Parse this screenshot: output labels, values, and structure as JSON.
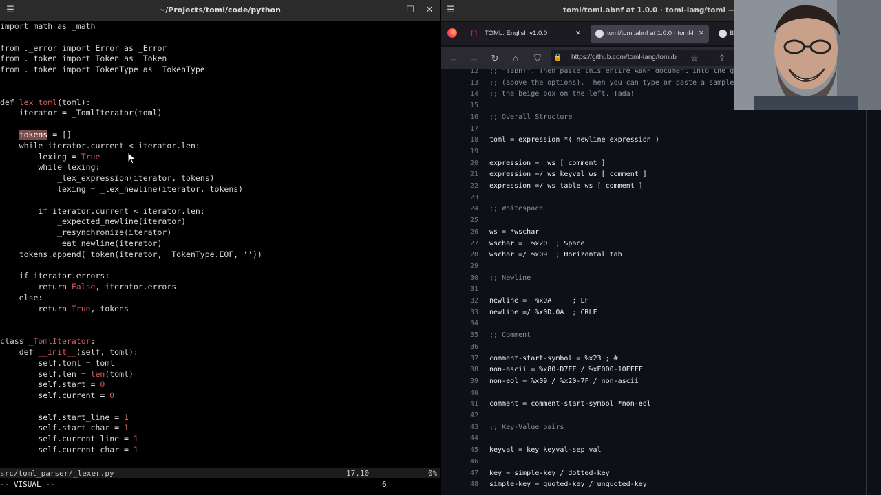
{
  "terminal": {
    "title": "~/Projects/toml/code/python",
    "statusline": {
      "file": "src/toml_parser/_lexer.py",
      "position": "17,10",
      "percent": "0%"
    },
    "mode": "-- VISUAL --",
    "selection_count": "6",
    "code_lines": [
      [
        {
          "t": "import",
          "c": "kw"
        },
        {
          "t": " math as _math"
        }
      ],
      [],
      [
        {
          "t": "from",
          "c": "kw"
        },
        {
          "t": " ._error "
        },
        {
          "t": "import",
          "c": "kw"
        },
        {
          "t": " Error as _Error"
        }
      ],
      [
        {
          "t": "from",
          "c": "kw"
        },
        {
          "t": " ._token "
        },
        {
          "t": "import",
          "c": "kw"
        },
        {
          "t": " Token as _Token"
        }
      ],
      [
        {
          "t": "from",
          "c": "kw"
        },
        {
          "t": " ._token "
        },
        {
          "t": "import",
          "c": "kw"
        },
        {
          "t": " TokenType as _TokenType"
        }
      ],
      [],
      [],
      [
        {
          "t": "def",
          "c": "kw"
        },
        {
          "t": " "
        },
        {
          "t": "lex_toml",
          "c": "fn"
        },
        {
          "t": "(toml):"
        }
      ],
      [
        {
          "t": "    iterator = _TomlIterator(toml)"
        }
      ],
      [],
      [
        {
          "t": "    "
        },
        {
          "t": "token",
          "c": "sel"
        },
        {
          "t": "s",
          "c": "sel"
        },
        {
          "t": " = []"
        }
      ],
      [
        {
          "t": "    while iterator.current < iterator.len:"
        }
      ],
      [
        {
          "t": "        lexing = "
        },
        {
          "t": "True",
          "c": "num"
        }
      ],
      [
        {
          "t": "        while lexing:"
        }
      ],
      [
        {
          "t": "            _lex_expression(iterator, tokens)"
        }
      ],
      [
        {
          "t": "            lexing = _lex_newline(iterator, tokens)"
        }
      ],
      [],
      [
        {
          "t": "        if iterator.current < iterator.len:"
        }
      ],
      [
        {
          "t": "            _expected_newline(iterator)"
        }
      ],
      [
        {
          "t": "            _resynchronize(iterator)"
        }
      ],
      [
        {
          "t": "            _eat_newline(iterator)"
        }
      ],
      [
        {
          "t": "    tokens.append(_token(iterator, _TokenType.EOF, '')"
        },
        {
          "t": ")"
        }
      ],
      [],
      [
        {
          "t": "    if iterator.errors:"
        }
      ],
      [
        {
          "t": "        return "
        },
        {
          "t": "False",
          "c": "num"
        },
        {
          "t": ", iterator.errors"
        }
      ],
      [
        {
          "t": "    else:"
        }
      ],
      [
        {
          "t": "        return "
        },
        {
          "t": "True",
          "c": "num"
        },
        {
          "t": ", tokens"
        }
      ],
      [],
      [],
      [
        {
          "t": "class",
          "c": "kw"
        },
        {
          "t": " "
        },
        {
          "t": "_TomlIterator",
          "c": "cls"
        },
        {
          "t": ":"
        }
      ],
      [
        {
          "t": "    def "
        },
        {
          "t": "__init__",
          "c": "fn"
        },
        {
          "t": "(self, toml):"
        }
      ],
      [
        {
          "t": "        self.toml = toml"
        }
      ],
      [
        {
          "t": "        self.len = "
        },
        {
          "t": "len",
          "c": "fn"
        },
        {
          "t": "(toml)"
        }
      ],
      [
        {
          "t": "        self.start = "
        },
        {
          "t": "0",
          "c": "num"
        }
      ],
      [
        {
          "t": "        self.current = "
        },
        {
          "t": "0",
          "c": "num"
        }
      ],
      [],
      [
        {
          "t": "        self.start_line = "
        },
        {
          "t": "1",
          "c": "num"
        }
      ],
      [
        {
          "t": "        self.start_char = "
        },
        {
          "t": "1",
          "c": "num"
        }
      ],
      [
        {
          "t": "        self.current_line = "
        },
        {
          "t": "1",
          "c": "num"
        }
      ],
      [
        {
          "t": "        self.current_char = "
        },
        {
          "t": "1",
          "c": "num"
        }
      ]
    ]
  },
  "browser": {
    "title": "toml/toml.abnf at 1.0.0 · toml-lang/toml — Mozilla",
    "tabs": [
      {
        "label": "TOML: English v1.0.0",
        "active": false
      },
      {
        "label": "toml/toml.abnf at 1.0.0 · toml-l",
        "active": true
      },
      {
        "label": "B",
        "active": false
      }
    ],
    "url": "https://github.com/toml-lang/toml/b",
    "abnf_lines": [
      {
        "n": "12",
        "t": ";; \"!abnf\". Then paste this entire ABNF document into the gr",
        "comment": true
      },
      {
        "n": "13",
        "t": ";; (above the options). Then you can type or paste a sample",
        "comment": true
      },
      {
        "n": "14",
        "t": ";; the beige box on the left. Tada!",
        "comment": true
      },
      {
        "n": "15",
        "t": ""
      },
      {
        "n": "16",
        "t": ";; Overall Structure",
        "comment": true
      },
      {
        "n": "17",
        "t": ""
      },
      {
        "n": "18",
        "t": "toml = expression *( newline expression )"
      },
      {
        "n": "19",
        "t": ""
      },
      {
        "n": "20",
        "t": "expression =  ws [ comment ]"
      },
      {
        "n": "21",
        "t": "expression =/ ws keyval ws [ comment ]"
      },
      {
        "n": "22",
        "t": "expression =/ ws table ws [ comment ]"
      },
      {
        "n": "23",
        "t": ""
      },
      {
        "n": "24",
        "t": ";; Whitespace",
        "comment": true
      },
      {
        "n": "25",
        "t": ""
      },
      {
        "n": "26",
        "t": "ws = *wschar"
      },
      {
        "n": "27",
        "t": "wschar =  %x20  ; Space"
      },
      {
        "n": "28",
        "t": "wschar =/ %x09  ; Horizontal tab"
      },
      {
        "n": "29",
        "t": ""
      },
      {
        "n": "30",
        "t": ";; Newline",
        "comment": true
      },
      {
        "n": "31",
        "t": ""
      },
      {
        "n": "32",
        "t": "newline =  %x0A     ; LF"
      },
      {
        "n": "33",
        "t": "newline =/ %x0D.0A  ; CRLF"
      },
      {
        "n": "34",
        "t": ""
      },
      {
        "n": "35",
        "t": ";; Comment",
        "comment": true
      },
      {
        "n": "36",
        "t": ""
      },
      {
        "n": "37",
        "t": "comment-start-symbol = %x23 ; #"
      },
      {
        "n": "38",
        "t": "non-ascii = %x80-D7FF / %xE000-10FFFF"
      },
      {
        "n": "39",
        "t": "non-eol = %x09 / %x20-7F / non-ascii"
      },
      {
        "n": "40",
        "t": ""
      },
      {
        "n": "41",
        "t": "comment = comment-start-symbol *non-eol"
      },
      {
        "n": "42",
        "t": ""
      },
      {
        "n": "43",
        "t": ";; Key-Value pairs",
        "comment": true
      },
      {
        "n": "44",
        "t": ""
      },
      {
        "n": "45",
        "t": "keyval = key keyval-sep val"
      },
      {
        "n": "46",
        "t": ""
      },
      {
        "n": "47",
        "t": "key = simple-key / dotted-key"
      },
      {
        "n": "48",
        "t": "simple-key = quoted-key / unquoted-key"
      }
    ]
  }
}
